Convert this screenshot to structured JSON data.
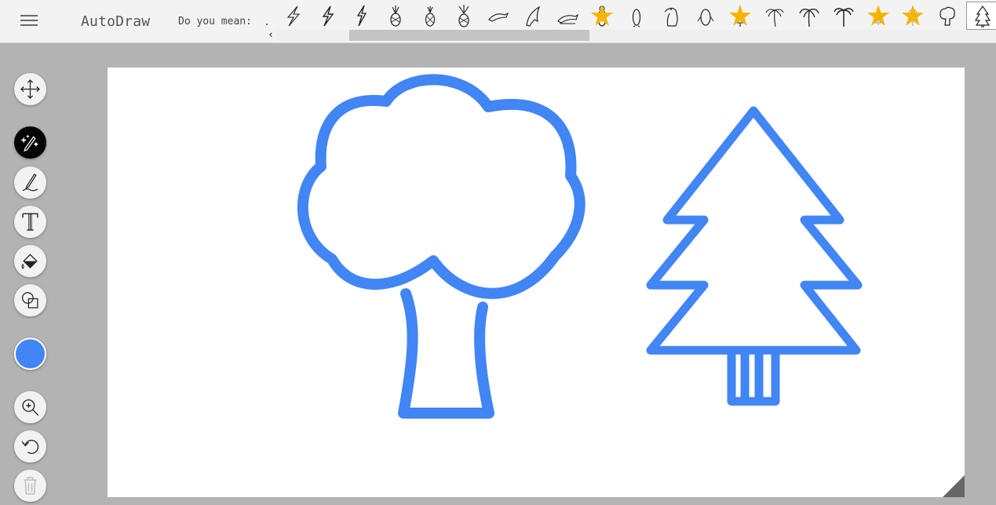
{
  "app": {
    "title": "AutoDraw"
  },
  "toolbar": {
    "menu_icon": "hamburger-icon",
    "suggest_label": "Do you mean:",
    "suggest_dot": "."
  },
  "suggestions": [
    {
      "icon": "lightning-bolt-icon",
      "starred": false
    },
    {
      "icon": "lightning-bolt-icon",
      "starred": false
    },
    {
      "icon": "lightning-bolt-icon",
      "starred": false
    },
    {
      "icon": "pineapple-icon",
      "starred": false
    },
    {
      "icon": "pineapple-icon",
      "starred": false
    },
    {
      "icon": "pineapple-icon",
      "starred": false
    },
    {
      "icon": "dolphin-icon",
      "starred": false
    },
    {
      "icon": "dolphin-icon",
      "starred": false
    },
    {
      "icon": "dolphin-icon",
      "starred": false
    },
    {
      "icon": "penguin-icon",
      "starred": true
    },
    {
      "icon": "penguin-icon",
      "starred": false
    },
    {
      "icon": "penguin-icon",
      "starred": false
    },
    {
      "icon": "penguin-icon",
      "starred": false
    },
    {
      "icon": "pine-tree-icon",
      "starred": true
    },
    {
      "icon": "palm-tree-icon",
      "starred": false
    },
    {
      "icon": "palm-tree-icon",
      "starred": false
    },
    {
      "icon": "palm-tree-icon",
      "starred": false
    },
    {
      "icon": "pine-tree-icon",
      "starred": true
    },
    {
      "icon": "lollipop-tree-icon",
      "starred": true
    },
    {
      "icon": "round-tree-icon",
      "starred": false
    },
    {
      "icon": "fir-tree-icon",
      "starred": false,
      "active": true
    }
  ],
  "scroll": {
    "left_arrow": "‹"
  },
  "tools": [
    {
      "name": "move-tool",
      "icon": "move-arrows-icon"
    },
    {
      "name": "autodraw-tool",
      "icon": "magic-pencil-icon",
      "selected": true
    },
    {
      "name": "draw-tool",
      "icon": "pencil-icon"
    },
    {
      "name": "type-tool",
      "icon": "text-t-icon"
    },
    {
      "name": "fill-tool",
      "icon": "paint-bucket-icon"
    },
    {
      "name": "shape-tool",
      "icon": "shapes-icon"
    },
    {
      "name": "color-picker",
      "icon": "color-swatch-icon"
    },
    {
      "name": "zoom-tool",
      "icon": "zoom-in-icon"
    },
    {
      "name": "undo-button",
      "icon": "undo-icon"
    },
    {
      "name": "delete-button",
      "icon": "trash-icon",
      "disabled": true
    }
  ],
  "colors": {
    "stroke": "#4285f4",
    "topbar_bg": "#f3f3f3",
    "workspace_bg": "#b3b3b3",
    "star": "#f4b400"
  },
  "canvas": {
    "drawings": [
      "round-tree-drawing",
      "fir-tree-drawing"
    ]
  }
}
